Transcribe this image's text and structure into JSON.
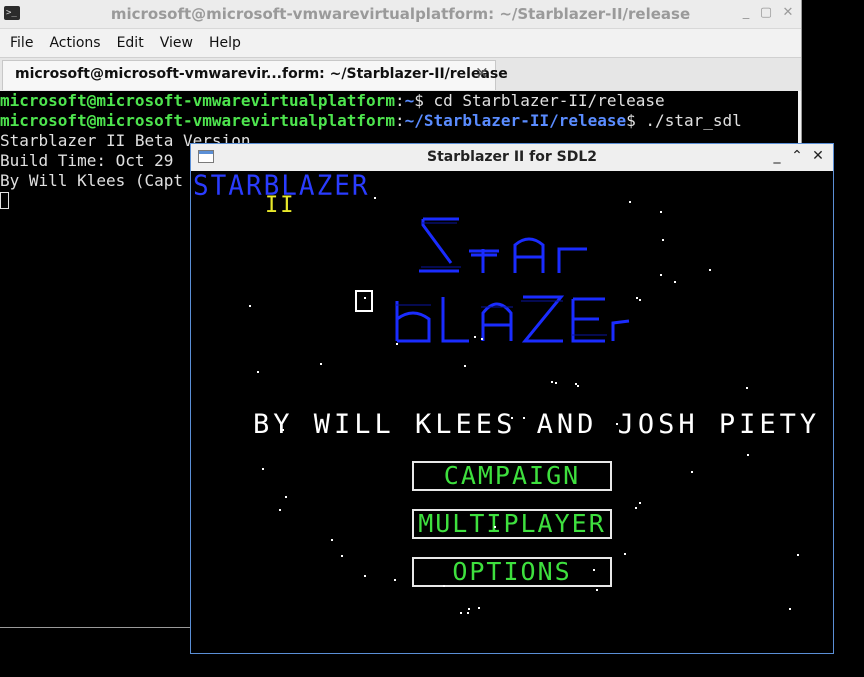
{
  "terminal": {
    "window_title": "microsoft@microsoft-vmwarevirtualplatform: ~/Starblazer-II/release",
    "menu": [
      "File",
      "Actions",
      "Edit",
      "View",
      "Help"
    ],
    "tab_label": "microsoft@microsoft-vmwarevir...form: ~/Starblazer-II/release",
    "tab_close": "×",
    "lines": [
      {
        "user": "microsoft@microsoft-vmwarevirtualplatform",
        "sep": ":",
        "path": "~",
        "prompt": "$ ",
        "cmd": "cd Starblazer-II/release"
      },
      {
        "user": "microsoft@microsoft-vmwarevirtualplatform",
        "sep": ":",
        "path": "~/Starblazer-II/release",
        "prompt": "$ ",
        "cmd": "./star_sdl"
      }
    ],
    "output": [
      "Starblazer II Beta Version",
      "Build Time: Oct 29",
      "By Will Klees (Capt"
    ]
  },
  "game": {
    "window_title": "Starblazer II for SDL2",
    "title_small": "STARBLAZER",
    "title_ii": "II",
    "logo_line1": "StAr",
    "logo_line2": "bLAZEr",
    "byline": "BY WILL KLEES AND JOSH PIETY",
    "buttons": [
      "CAMPAIGN",
      "MULTIPLAYER",
      "OPTIONS"
    ]
  },
  "icons": {
    "terminal_app": "terminal-icon",
    "minimize": "minimize-icon",
    "maximize": "maximize-icon",
    "close": "close-icon"
  },
  "colors": {
    "prompt_user": "#4ee44e",
    "prompt_path": "#5a8cff",
    "logo_blue": "#1a2cff",
    "menu_green": "#3ee03e",
    "roman_yellow": "#e8e82a",
    "window_border": "#5b8fd6"
  }
}
